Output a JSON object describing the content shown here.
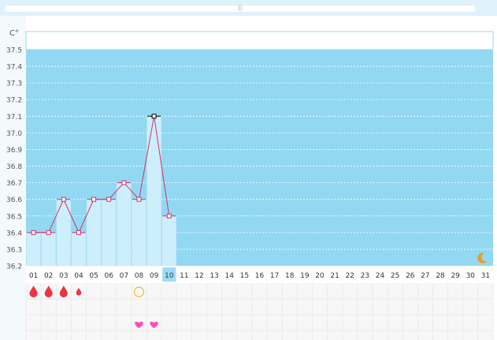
{
  "top_bar": {
    "grip_glyph": "||"
  },
  "chart_data": {
    "type": "bar",
    "unit_label": "C°",
    "ylim": [
      36.2,
      37.5
    ],
    "y_ticks": [
      "36.2",
      "36.3",
      "36.4",
      "36.5",
      "36.6",
      "36.7",
      "36.8",
      "36.9",
      "37.0",
      "37.1",
      "37.2",
      "37.3",
      "37.4",
      "37.5"
    ],
    "categories": [
      "01",
      "02",
      "03",
      "04",
      "05",
      "06",
      "07",
      "08",
      "09",
      "10",
      "11",
      "12",
      "13",
      "14",
      "15",
      "16",
      "17",
      "18",
      "19",
      "20",
      "21",
      "22",
      "23",
      "24",
      "25",
      "26",
      "27",
      "28",
      "29",
      "30",
      "31"
    ],
    "series": [
      {
        "values": [
          36.4,
          36.4,
          36.6,
          36.4,
          36.6,
          36.6,
          36.7,
          36.6,
          37.1,
          36.5
        ]
      }
    ],
    "highlighted_day": "10",
    "grid": true,
    "colors": {
      "plot_background": "#93d8f3",
      "bar_fill": "#cdeefb",
      "line": "#d0306a",
      "marker_fill": "#ffffff",
      "peak_marker": "#000000",
      "highlight_day_bg": "#9ddcf4"
    },
    "markers": {
      "period_days": [
        {
          "day": "01",
          "intensity": "heavy"
        },
        {
          "day": "02",
          "intensity": "heavy"
        },
        {
          "day": "03",
          "intensity": "heavy"
        },
        {
          "day": "04",
          "intensity": "light"
        }
      ],
      "ovulation_day": "08",
      "intercourse_days": [
        "08",
        "09"
      ],
      "night_icon": "moon-icon"
    }
  }
}
